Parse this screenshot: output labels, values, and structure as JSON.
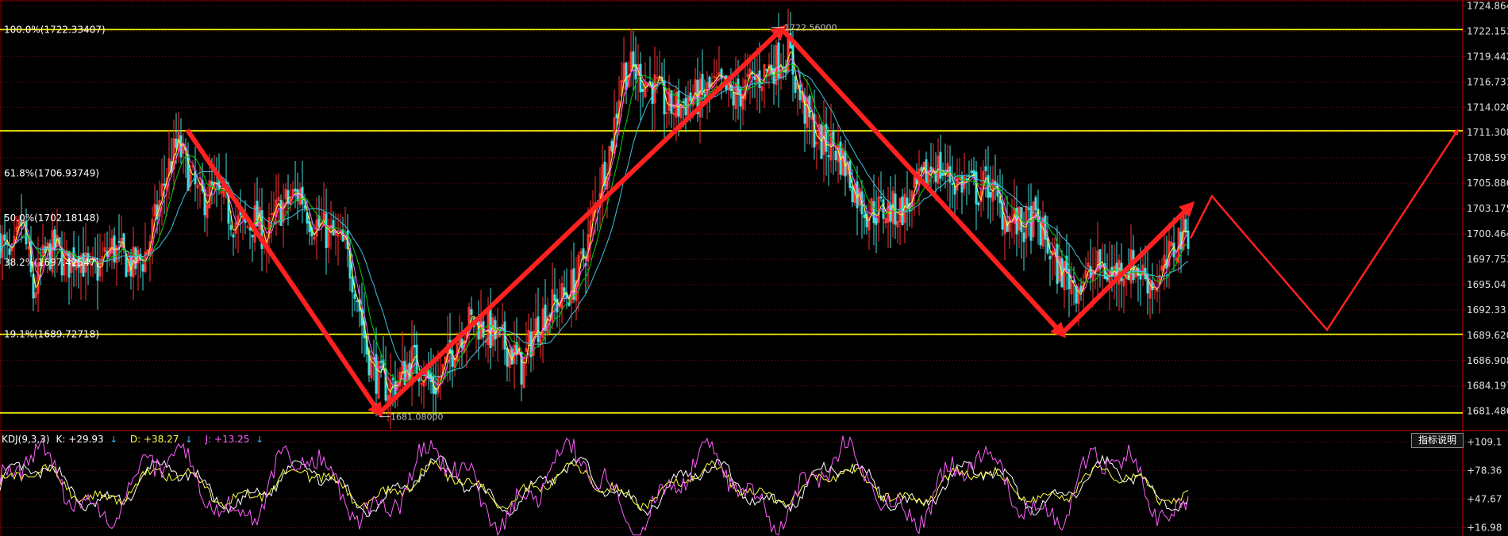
{
  "chart_data": [
    {
      "type": "candlestick",
      "title": "",
      "ylim": [
        1680.1,
        1725.5
      ],
      "price_axis_ticks": [
        "1724.864",
        "1722.153",
        "1719.442",
        "1716.731",
        "1714.020",
        "1711.308",
        "1708.597",
        "1705.886",
        "1703.175",
        "1700.464",
        "1697.753",
        "1695.04",
        "1692.33",
        "1689.620",
        "1686.908",
        "1684.197",
        "1681.486"
      ],
      "price_axis_values": [
        1724.864,
        1722.153,
        1719.442,
        1716.731,
        1714.02,
        1711.308,
        1708.597,
        1705.886,
        1703.175,
        1700.464,
        1697.753,
        1695.04,
        1692.33,
        1689.62,
        1686.908,
        1684.197,
        1681.486
      ],
      "fibonacci_levels": [
        {
          "label": "100.0%(1722.33407)",
          "value": 1722.33407
        },
        {
          "label": "61.8%(1706.93749)",
          "value": 1706.93749
        },
        {
          "label": "50.0%(1702.18148)",
          "value": 1702.18148
        },
        {
          "label": "38.2%(1697.42547)",
          "value": 1697.42547
        },
        {
          "label": "19.1%(1689.72718)",
          "value": 1689.72718
        }
      ],
      "horizontal_levels": [
        1722.33407,
        1711.5,
        1689.72718,
        1681.3
      ],
      "extremes": [
        {
          "label": "1722.56000",
          "value": 1722.56
        },
        {
          "label": "1681.08000",
          "value": 1681.08
        }
      ],
      "price_path": [
        [
          0,
          1700
        ],
        [
          14,
          1697
        ],
        [
          28,
          1702
        ],
        [
          42,
          1694
        ],
        [
          56,
          1698
        ],
        [
          70,
          1699
        ],
        [
          84,
          1697
        ],
        [
          98,
          1699
        ],
        [
          112,
          1696
        ],
        [
          126,
          1697
        ],
        [
          140,
          1699
        ],
        [
          154,
          1698
        ],
        [
          168,
          1697
        ],
        [
          182,
          1698
        ],
        [
          196,
          1702
        ],
        [
          210,
          1707
        ],
        [
          224,
          1710
        ],
        [
          238,
          1707
        ],
        [
          252,
          1704
        ],
        [
          266,
          1705
        ],
        [
          280,
          1704
        ],
        [
          294,
          1702
        ],
        [
          308,
          1701
        ],
        [
          322,
          1702
        ],
        [
          336,
          1700
        ],
        [
          350,
          1703
        ],
        [
          364,
          1704
        ],
        [
          378,
          1705
        ],
        [
          392,
          1702
        ],
        [
          406,
          1701
        ],
        [
          420,
          1700
        ],
        [
          434,
          1699
        ],
        [
          448,
          1695
        ],
        [
          462,
          1688
        ],
        [
          476,
          1685
        ],
        [
          490,
          1684
        ],
        [
          504,
          1685
        ],
        [
          518,
          1687
        ],
        [
          532,
          1686
        ],
        [
          546,
          1684
        ],
        [
          560,
          1686
        ],
        [
          574,
          1689
        ],
        [
          588,
          1691
        ],
        [
          602,
          1691
        ],
        [
          616,
          1690
        ],
        [
          630,
          1689
        ],
        [
          644,
          1688
        ],
        [
          658,
          1686
        ],
        [
          672,
          1690
        ],
        [
          686,
          1692
        ],
        [
          700,
          1693
        ],
        [
          714,
          1694
        ],
        [
          728,
          1696
        ],
        [
          742,
          1700
        ],
        [
          756,
          1706
        ],
        [
          770,
          1710
        ],
        [
          784,
          1718
        ],
        [
          798,
          1718
        ],
        [
          812,
          1717
        ],
        [
          826,
          1716
        ],
        [
          840,
          1714
        ],
        [
          854,
          1714
        ],
        [
          868,
          1715
        ],
        [
          882,
          1715
        ],
        [
          896,
          1716
        ],
        [
          910,
          1716
        ],
        [
          924,
          1715
        ],
        [
          938,
          1716
        ],
        [
          952,
          1717
        ],
        [
          966,
          1718
        ],
        [
          980,
          1719
        ],
        [
          994,
          1720
        ],
        [
          1008,
          1715
        ],
        [
          1022,
          1712
        ],
        [
          1036,
          1710
        ],
        [
          1050,
          1710
        ],
        [
          1064,
          1708
        ],
        [
          1078,
          1705
        ],
        [
          1092,
          1703
        ],
        [
          1106,
          1703
        ],
        [
          1120,
          1703
        ],
        [
          1134,
          1703
        ],
        [
          1148,
          1704
        ],
        [
          1162,
          1706
        ],
        [
          1176,
          1708
        ],
        [
          1190,
          1707
        ],
        [
          1204,
          1706
        ],
        [
          1218,
          1706
        ],
        [
          1232,
          1705
        ],
        [
          1246,
          1706
        ],
        [
          1260,
          1703
        ],
        [
          1274,
          1702
        ],
        [
          1288,
          1701
        ],
        [
          1302,
          1702
        ],
        [
          1316,
          1700
        ],
        [
          1330,
          1697
        ],
        [
          1344,
          1696
        ],
        [
          1358,
          1695
        ],
        [
          1372,
          1696
        ],
        [
          1386,
          1697
        ],
        [
          1400,
          1696
        ],
        [
          1414,
          1697
        ],
        [
          1428,
          1697
        ],
        [
          1442,
          1696
        ],
        [
          1456,
          1695
        ],
        [
          1470,
          1697
        ],
        [
          1484,
          1700
        ],
        [
          1498,
          1701
        ]
      ],
      "projection_path": [
        [
          1500,
          1700
        ],
        [
          1527,
          1704.5
        ],
        [
          1672,
          1690.2
        ],
        [
          1836,
          1711.5
        ]
      ],
      "trend_lines": [
        [
          [
            236,
            1711.6
          ],
          [
            478,
            1681.3
          ]
        ],
        [
          [
            478,
            1681.3
          ],
          [
            985,
            1722.4
          ]
        ],
        [
          [
            985,
            1722.4
          ],
          [
            1338,
            1689.8
          ]
        ],
        [
          [
            1338,
            1689.8
          ],
          [
            1500,
            1703.5
          ]
        ]
      ]
    },
    {
      "type": "line",
      "title": "",
      "ylim": [
        8,
        117
      ],
      "axis_ticks": [
        "+109.1",
        "+78.36",
        "+47.67",
        "+16.98"
      ],
      "axis_values": [
        109.1,
        78.36,
        47.67,
        16.98
      ],
      "series": [
        {
          "name": "K",
          "value": "+29.93",
          "color": "#ffffff"
        },
        {
          "name": "D",
          "value": "+38.27",
          "color": "#ffff40"
        },
        {
          "name": "J",
          "value": "+13.25",
          "color": "#ff60ff"
        }
      ]
    }
  ],
  "kdj": {
    "label": "KDJ(9,3,3)",
    "k_label": "K: +29.93",
    "d_label": "D: +38.27",
    "j_label": "J: +13.25",
    "arrow": "↓"
  },
  "indicator_button": "指标说明",
  "colors": {
    "background": "#000000",
    "frame": "#8b0000",
    "yellow_level": "#ffff00",
    "arrow": "#ff2020",
    "candle_up": "#ff3030",
    "candle_down": "#40e0e0",
    "ma_yellow": "#ffff40",
    "ma_magenta": "#ff60ff",
    "ma_green": "#00d000",
    "ma_cyan": "#40c0e0"
  }
}
